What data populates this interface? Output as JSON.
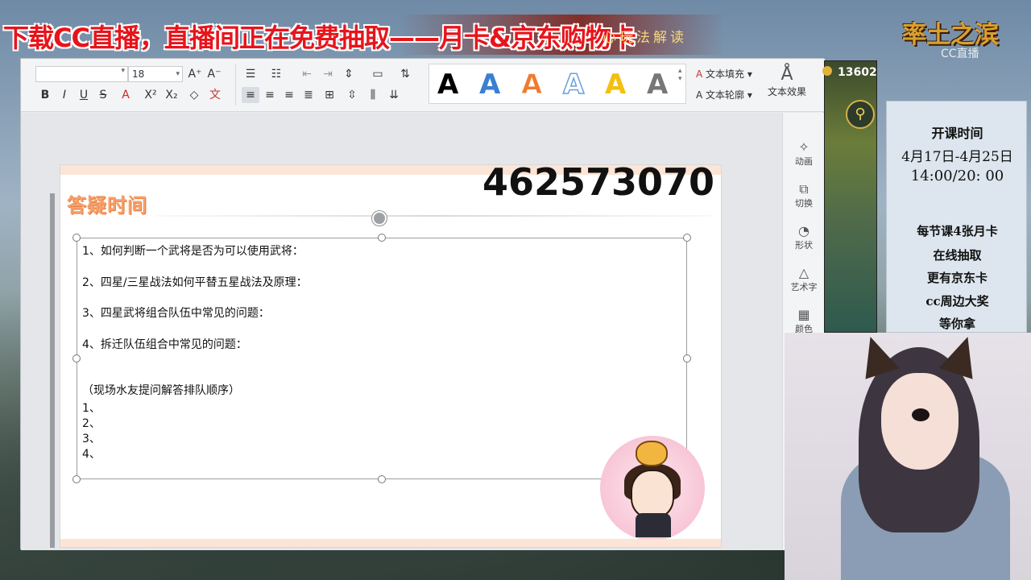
{
  "banner": {
    "promo_text": "下载CC直播，直播间正在免费抽取——月卡&京东购物卡",
    "sub_text": "心玩法解读",
    "game_logo": "率土之滨",
    "cc_logo": "CC直播"
  },
  "ribbon": {
    "font_name": "",
    "font_size": "18",
    "buttons": {
      "grow_font": "A⁺",
      "shrink_font": "A⁻",
      "bold": "B",
      "italic": "I",
      "underline": "U",
      "strike": "S",
      "font_color": "A",
      "superscript": "X²",
      "subscript": "X₂",
      "clear_format": "◇",
      "phonetic": "文"
    },
    "art_text_label": "A",
    "text_fill_label": "文本填充",
    "text_outline_label": "文本轮廓",
    "text_effect_label": "文本效果",
    "art_colors": [
      "#000000",
      "#3a7fd1",
      "#f07a2e",
      "#6aa0d8",
      "#f2c011",
      "#777777"
    ]
  },
  "slide": {
    "title": "答疑时间",
    "room_number": "462573070",
    "questions": [
      "1、如何判断一个武将是否为可以使用武将：",
      "2、四星/三星战法如何平替五星战法及原理：",
      "3、四星武将组合队伍中常见的问题：",
      "4、拆迁队伍组合中常见的问题："
    ],
    "queue_note": "（现场水友提问解答排队顺序）",
    "queue_items": [
      "1、",
      "2、",
      "3、",
      "4、"
    ]
  },
  "side_panel": {
    "items": [
      {
        "label": "动画",
        "icon": "star-icon"
      },
      {
        "label": "切换",
        "icon": "transition-icon"
      },
      {
        "label": "形状",
        "icon": "shape-icon"
      },
      {
        "label": "艺术字",
        "icon": "art-text-icon"
      },
      {
        "label": "颜色",
        "icon": "palette-icon"
      }
    ]
  },
  "game": {
    "coins": "13602"
  },
  "schedule": {
    "heading": "开课时间",
    "dates": "4月17日-4月25日",
    "times": "14:00/20: 00",
    "prize_line1": "每节课4张月卡",
    "prize_line2": "在线抽取",
    "prize_line3": "更有京东卡",
    "prize_line4": "cc周边大奖",
    "prize_line5": "等你拿"
  }
}
